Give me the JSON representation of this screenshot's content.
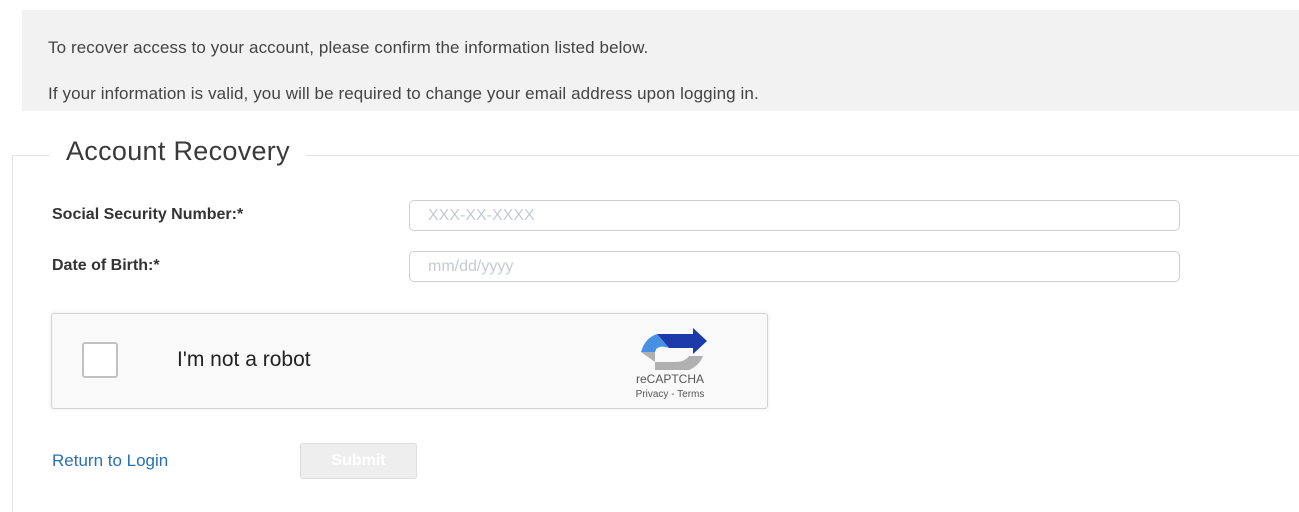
{
  "info": {
    "line1": "To recover access to your account, please confirm the information listed below.",
    "line2": "If your information is valid, you will be required to change your email address upon logging in."
  },
  "form": {
    "legend": "Account Recovery",
    "ssn": {
      "label": "Social Security Number:*",
      "placeholder": "XXX-XX-XXXX",
      "value": ""
    },
    "dob": {
      "label": "Date of Birth:*",
      "placeholder": "mm/dd/yyyy",
      "value": ""
    }
  },
  "recaptcha": {
    "label": "I'm not a robot",
    "checked": false,
    "brand": "reCAPTCHA",
    "privacy": "Privacy",
    "separator": " - ",
    "terms": "Terms",
    "icon": "recaptcha-logo-icon"
  },
  "actions": {
    "return_label": "Return to Login",
    "submit_label": "Submit",
    "submit_disabled": true
  },
  "colors": {
    "link": "#2a6fb0",
    "banner_bg": "#f2f2f2",
    "submit_disabled_bg": "#eeeeee",
    "recaptcha_blue": "#1c3aa9",
    "recaptcha_light_blue": "#4a90e2",
    "recaptcha_gray": "#b0b0b0"
  }
}
